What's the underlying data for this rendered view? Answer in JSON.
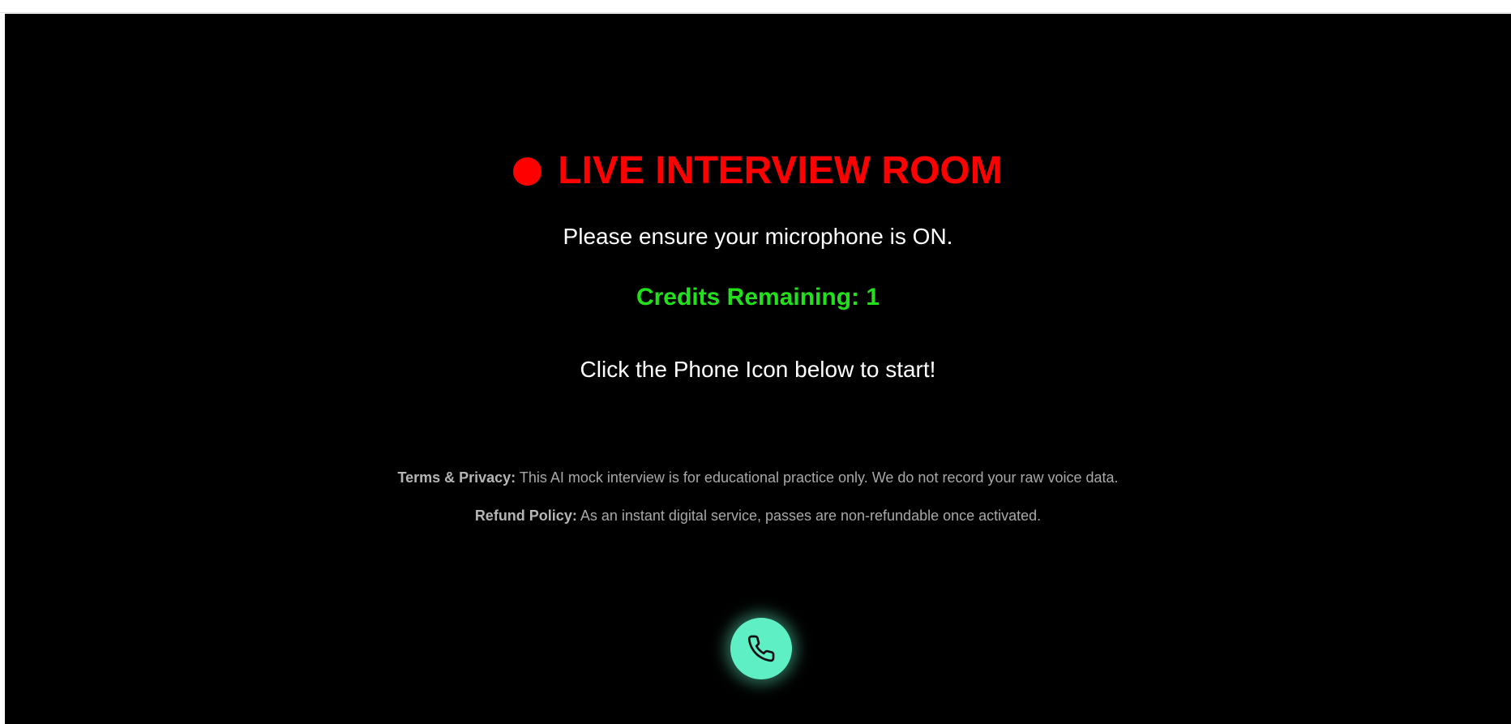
{
  "room": {
    "title": "LIVE INTERVIEW ROOM",
    "mic_note": "Please ensure your microphone is ON.",
    "credits": "Credits Remaining: 1",
    "start_note": "Click the Phone Icon below to start!"
  },
  "legal": {
    "terms_label": "Terms & Privacy:",
    "terms_text": "This AI mock interview is for educational practice only. We do not record your raw voice data.",
    "refund_label": "Refund Policy:",
    "refund_text": "As an instant digital service, passes are non-refundable once activated."
  },
  "call_button": {
    "icon": "phone-icon",
    "color": "#5fefc4"
  },
  "colors": {
    "title": "#ff0000",
    "credits": "#22e01a",
    "background": "#000000"
  }
}
